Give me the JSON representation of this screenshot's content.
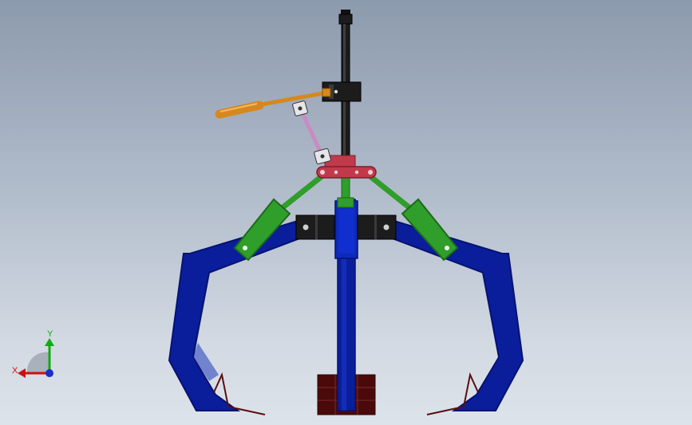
{
  "triad": {
    "x_label": "X",
    "y_label": "Y"
  },
  "colors": {
    "arm_blue": "#0a1e9c",
    "arm_blue_dark": "#061270",
    "link_green": "#2f9e2a",
    "link_green_dark": "#1d6a1a",
    "rod_black": "#1c1c1c",
    "bracket_red": "#c13a4c",
    "handle_orange": "#d6881e",
    "pink_link": "#c98ac4",
    "base_maroon": "#4a0a0a",
    "axis_x": "#cc1111",
    "axis_y": "#11aa11",
    "axis_z": "#1a2ec8"
  },
  "icons": {
    "triad": "coordinate-triad-icon"
  }
}
